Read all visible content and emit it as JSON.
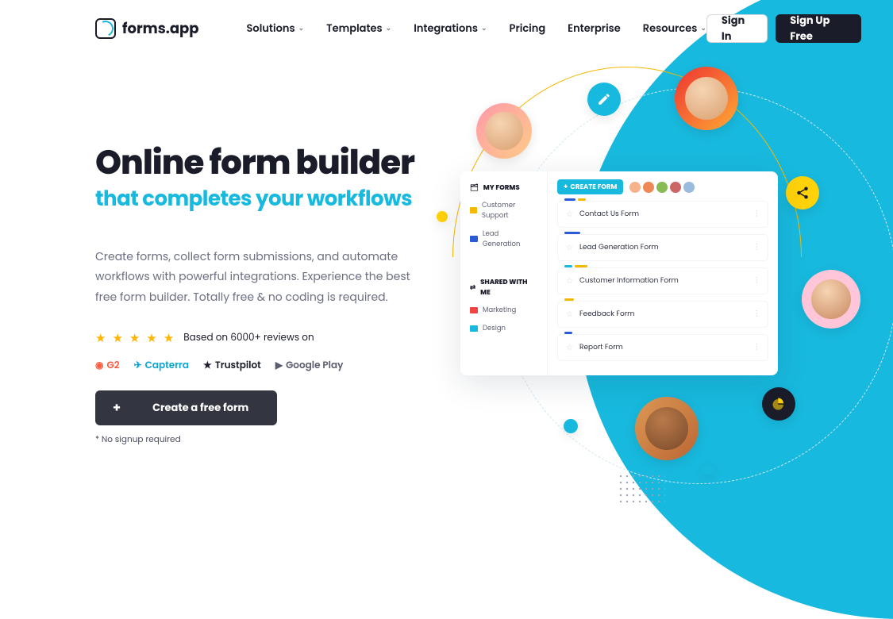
{
  "brand": "forms.app",
  "nav": [
    "Solutions",
    "Templates",
    "Integrations",
    "Pricing",
    "Enterprise",
    "Resources"
  ],
  "nav_has_chev": [
    true,
    true,
    true,
    false,
    false,
    true
  ],
  "auth": {
    "sign_in": "Sign In",
    "sign_up": "Sign Up Free"
  },
  "hero": {
    "h1": "Online form builder",
    "h2": "that completes your workflows",
    "lead": "Create forms, collect form submissions, and automate workflows with powerful integrations. Experience the best free form builder. Totally free & no coding is required.",
    "reviews_text": "Based on 6000+ reviews on",
    "badges": {
      "g2": "G2",
      "capterra": "Capterra",
      "trustpilot": "Trustpilot",
      "googleplay": "Google Play"
    },
    "cta": "Create a free form",
    "note": "* No signup required"
  },
  "panel": {
    "my_forms": "MY FORMS",
    "folders_a": [
      {
        "name": "Customer Support",
        "color": "#f5b800"
      },
      {
        "name": "Lead Generation",
        "color": "#2a5bd7"
      }
    ],
    "shared": "SHARED WITH ME",
    "folders_b": [
      {
        "name": "Marketing",
        "color": "#e44"
      },
      {
        "name": "Design",
        "color": "#18b9de"
      }
    ],
    "create": "CREATE FORM",
    "cards": [
      {
        "name": "Contact Us Form",
        "bars": [
          [
            "#2a5bd7",
            14
          ],
          [
            "#f5b800",
            10
          ]
        ]
      },
      {
        "name": "Lead Generation Form",
        "bars": [
          [
            "#2a5bd7",
            20
          ]
        ]
      },
      {
        "name": "Customer Information Form",
        "bars": [
          [
            "#18b9de",
            10
          ],
          [
            "#f5b800",
            16
          ]
        ]
      },
      {
        "name": "Feedback Form",
        "bars": [
          [
            "#f5b800",
            12
          ]
        ]
      },
      {
        "name": "Report Form",
        "bars": [
          [
            "#2a5bd7",
            10
          ]
        ]
      }
    ]
  }
}
